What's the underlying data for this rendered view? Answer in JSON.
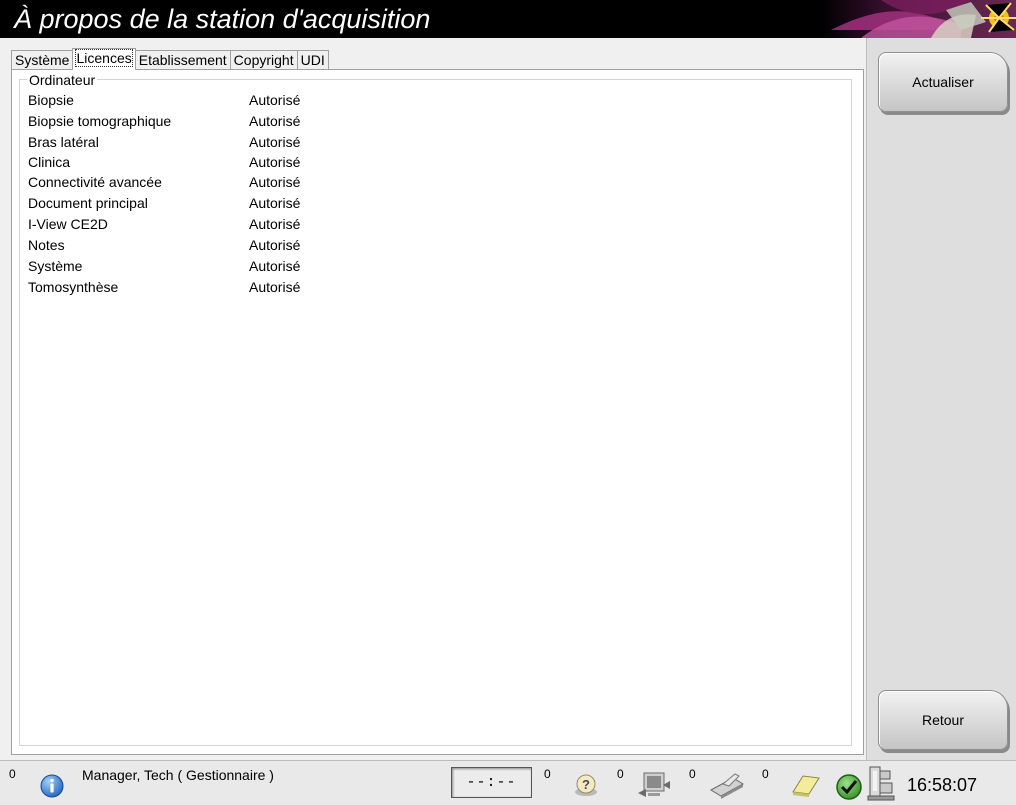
{
  "window": {
    "title": "À propos de la station d'acquisition"
  },
  "tabs": [
    {
      "label": "Système",
      "active": false
    },
    {
      "label": "Licences",
      "active": true
    },
    {
      "label": "Etablissement",
      "active": false
    },
    {
      "label": "Copyright",
      "active": false
    },
    {
      "label": "UDI",
      "active": false
    }
  ],
  "licenses": {
    "group_label": "Ordinateur",
    "rows": [
      {
        "name": "Biopsie",
        "status": "Autorisé"
      },
      {
        "name": "Biopsie tomographique",
        "status": "Autorisé"
      },
      {
        "name": "Bras latéral",
        "status": "Autorisé"
      },
      {
        "name": "Clinica",
        "status": "Autorisé"
      },
      {
        "name": "Connectivité avancée",
        "status": "Autorisé"
      },
      {
        "name": "Document principal",
        "status": "Autorisé"
      },
      {
        "name": "I-View CE2D",
        "status": "Autorisé"
      },
      {
        "name": "Notes",
        "status": "Autorisé"
      },
      {
        "name": "Système",
        "status": "Autorisé"
      },
      {
        "name": "Tomosynthèse",
        "status": "Autorisé"
      }
    ]
  },
  "sidebar": {
    "refresh_label": "Actualiser",
    "back_label": "Retour"
  },
  "statusbar": {
    "alarm_count": "0",
    "user": "Manager, Tech ( Gestionnaire )",
    "timer": "--:--",
    "query_count": "0",
    "output_count": "0",
    "print_count": "0",
    "notes_count": "0",
    "clock": "16:58:07"
  },
  "colors": {
    "title_bg": "#000000",
    "panel_bg": "#f0f0f0",
    "sidebar_bg": "#dedede",
    "status_ok": "#3a9a2a",
    "info_icon": "#1e6fd0"
  },
  "icons": {
    "info": "info-icon",
    "query": "question-icon",
    "output": "output-device-icon",
    "print": "printer-icon",
    "notes": "note-icon",
    "system_ok": "check-circle-icon",
    "tube": "xray-tube-icon"
  }
}
